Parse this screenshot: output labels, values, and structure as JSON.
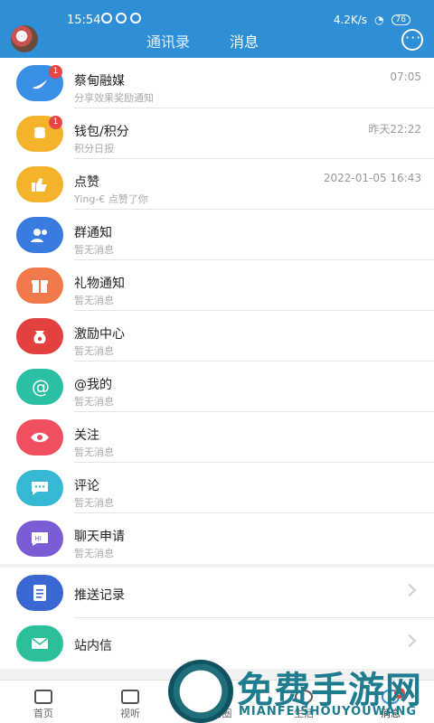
{
  "status_bar": {
    "time": "15:54",
    "network_speed": "4.2K/s",
    "battery": "76"
  },
  "header": {
    "tabs": [
      {
        "label": "通讯录"
      },
      {
        "label": "消息"
      }
    ],
    "active_tab": "消息",
    "chat_icon": "chat-bubble-icon",
    "avatar_icon": "avatar"
  },
  "messages": [
    {
      "title": "蔡甸融媒",
      "subtitle": "分享效果奖励通知",
      "time": "07:05",
      "badge": "1",
      "icon": "media-logo-icon",
      "color": "#3a8fe6"
    },
    {
      "title": "钱包/积分",
      "subtitle": "积分日报",
      "time": "昨天22:22",
      "badge": "1",
      "icon": "coins-icon",
      "color": "#f3b32b"
    },
    {
      "title": "点赞",
      "subtitle": "Ying-€ 点赞了你",
      "time": "2022-01-05 16:43",
      "badge": "",
      "icon": "thumbs-up-icon",
      "color": "#f3b32b"
    },
    {
      "title": "群通知",
      "subtitle": "暂无消息",
      "time": "",
      "badge": "",
      "icon": "group-icon",
      "color": "#3a7be0"
    },
    {
      "title": "礼物通知",
      "subtitle": "暂无消息",
      "time": "",
      "badge": "",
      "icon": "gift-icon",
      "color": "#f07a4b"
    },
    {
      "title": "激励中心",
      "subtitle": "暂无消息",
      "time": "",
      "badge": "",
      "icon": "reward-bag-icon",
      "color": "#e34040"
    },
    {
      "title": "@我的",
      "subtitle": "暂无消息",
      "time": "",
      "badge": "",
      "icon": "at-icon",
      "color": "#2bc0a4"
    },
    {
      "title": "关注",
      "subtitle": "暂无消息",
      "time": "",
      "badge": "",
      "icon": "eye-icon",
      "color": "#ef4f5f"
    },
    {
      "title": "评论",
      "subtitle": "暂无消息",
      "time": "",
      "badge": "",
      "icon": "comment-icon",
      "color": "#37b8d5"
    },
    {
      "title": "聊天申请",
      "subtitle": "暂无消息",
      "time": "",
      "badge": "",
      "icon": "hi-icon",
      "color": "#7c5bd6"
    }
  ],
  "shortcuts": [
    {
      "title": "推送记录",
      "icon": "document-icon",
      "color": "#3a67d1"
    },
    {
      "title": "站内信",
      "icon": "mail-icon",
      "color": "#2bbf9c"
    }
  ],
  "bottom_nav": [
    {
      "label": "首页",
      "icon": "home-icon"
    },
    {
      "label": "视听",
      "icon": "video-icon"
    },
    {
      "label": "蔡甸圈",
      "icon": "circle-icon"
    },
    {
      "label": "生活",
      "icon": "life-icon"
    },
    {
      "label": "消息",
      "icon": "message-icon",
      "badge": "2"
    }
  ],
  "watermark": {
    "title": "免费手游网",
    "subtitle": "MIANFEISHOUYOUWANG"
  }
}
